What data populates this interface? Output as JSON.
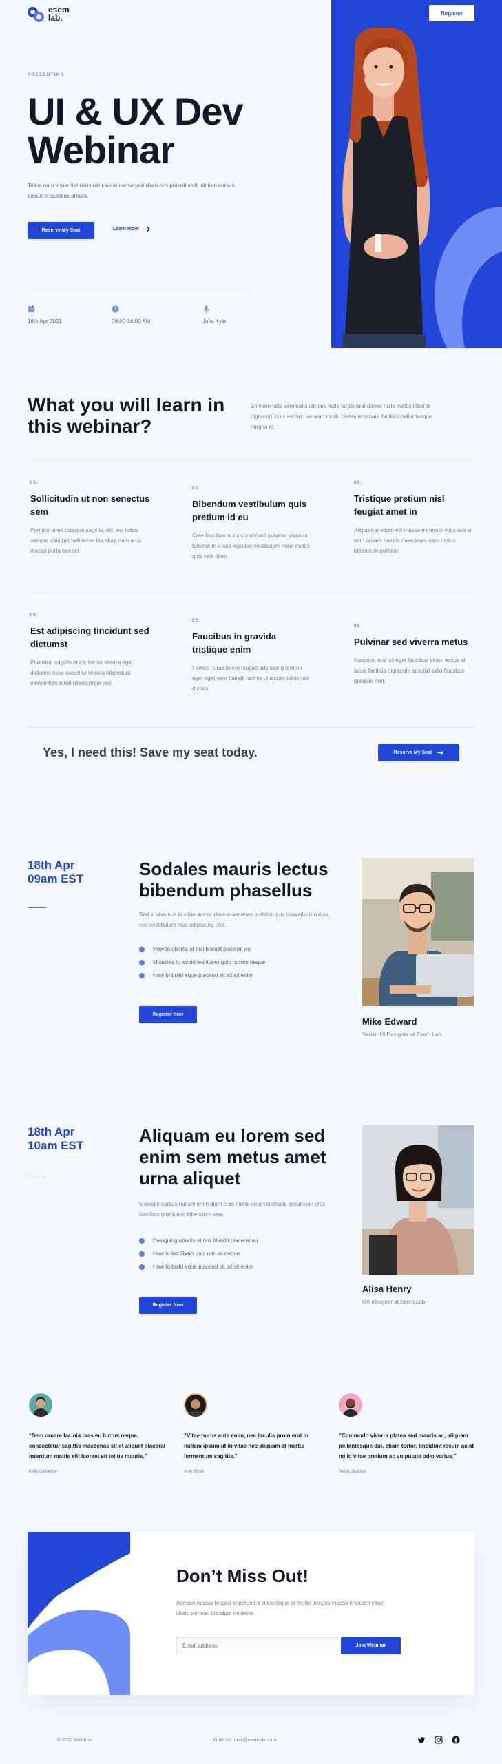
{
  "brand": {
    "name_line1": "esem",
    "name_line2": "lab."
  },
  "header": {
    "register_label": "Register"
  },
  "hero": {
    "eyebrow": "PRESENTING",
    "title_line1": "UI & UX Dev",
    "title_line2": "Webinar",
    "description": "Tellus nam imperdiet risus ultricies in consequat diam orci potenti velit, dictum cursus posuere faucibus ornare.",
    "reserve_label": "Reserve My Seat",
    "learn_more_label": "Learn More",
    "meta": {
      "date": "18th Apr 2021",
      "time": "09:00-10:00 AM",
      "host": "Julia Kyle"
    }
  },
  "learn": {
    "title": "What you will learn in this webinar?",
    "description": "Sit venenatis venenatis ultrices nulla turpis erat donec nulla mattis lobortis dignissim quis est orci aenean morbi platea et ornare facilisis pellentesque magna et.",
    "cards": [
      {
        "num": "01.",
        "title": "Sollicitudin ut non senectus sem",
        "desc": "Porttitor amet quisque sagittis, elit, est tellus semper volutpat habitasse tincidunt nam arcu massa porta laoreet."
      },
      {
        "num": "02.",
        "title": "Bibendum vestibulum quis pretium id eu",
        "desc": "Cras faucibus nunc consequat pulvinar vivamus bibendum a sed egestas vestibulum nunc mattis quis velit diam."
      },
      {
        "num": "03.",
        "title": "Tristique pretium nisl feugiat amet in",
        "desc": "Aliquam pretium elit massa mi morbi vulputate a sem ornare mauris maecenas nam metus bibendum porttitor."
      },
      {
        "num": "04.",
        "title": "Est adipiscing tincidunt sed dictumst",
        "desc": "Pharetra, sagittis enim, lectus viverra eget dictumst risus nascetur viverra bibendum elementum amet ullamcorper nisi."
      },
      {
        "num": "05.",
        "title": "Faucibus in gravida tristique enim",
        "desc": "Fames purus lorem feugiat adipiscing tempor eget eget sem blandit lacinia ut iaculis tellus nisl dictum."
      },
      {
        "num": "06.",
        "title": "Pulvinar sed viverra metus",
        "desc": "Nascetur erat sit eget faucibus etiam lectus id lacus facilisis dignissim suscipit odio faucibus quisque non."
      }
    ]
  },
  "cta": {
    "text": "Yes, I need this! Save my seat today.",
    "button_label": "Reserve My Seat"
  },
  "sessions": [
    {
      "date_line1": "18th Apr",
      "date_line2": "09am EST",
      "title": "Sodales mauris lectus bibendum phasellus",
      "desc": "Sed in vivamus in vitae auctor diam maecenas porttitor quis convallis rhoncus, nec vestibulum mus adipiscing orci.",
      "bullets": [
        "How to obortis et nisi blandit placerat eu",
        "Mistakes to avoid led libero quis rutrum neque",
        "How to build eque placerat sit sit sit enim"
      ],
      "button_label": "Register Now",
      "speaker_name": "Mike Edward",
      "speaker_role": "Senior UI Designer at Esem Lab"
    },
    {
      "date_line1": "18th Apr",
      "date_line2": "10am EST",
      "title": "Aliquam eu lorem sed enim sem metus amet urna aliquet",
      "desc": "Molestie cursus nullam enim diam cras morbi arcu venenatis accumsan cras faucibus morbi nec bibendum sem.",
      "bullets": [
        "Designing obortis et nisi blandit placerat eu",
        "How to led libero quis rutrum neque",
        "How to build eque placerat sit sit sit enim"
      ],
      "button_label": "Register Now",
      "speaker_name": "Alisa Henry",
      "speaker_role": "UX designer at Esem Lab"
    }
  ],
  "testimonials": [
    {
      "quote": "“Sem ornare lacinia cras eu luctus neque, consectetur sagittis maecenas sit et aliquet placerat interdum mattis elit laoreet sit tellus mauris.”",
      "author": "Kelly Catherine"
    },
    {
      "quote": "“Vitae purus ante enim, nec iaculis proin erat in nullam ipsum ut in vitae nec aliquam at mattis fermentum sagittis.”",
      "author": "Amy White"
    },
    {
      "quote": "“Commodo viverra platea sed mauris ac, aliquam pellentesque dui, etiam tortor, tincidunt ipsum ac at mi id vitae pretium ac vulputate odio varius.”",
      "author": "Teddy Jackson"
    }
  ],
  "newsletter": {
    "title": "Don’t Miss Out!",
    "desc": "Aenean massa feugiat imperdiet a scelerisque et morbi tempus massa tincidunt vitae libero aenean tincidunt molestie.",
    "placeholder": "Email address",
    "button_label": "Join Webinar"
  },
  "footer": {
    "copyright": "© 2022 Webinar",
    "contact": "Write Us: mail@example.com",
    "social": [
      "twitter-icon",
      "instagram-icon",
      "facebook-icon"
    ]
  },
  "colors": {
    "accent": "#2146d8",
    "accent_light": "#5b7cf0",
    "background": "#f5f8fe"
  }
}
